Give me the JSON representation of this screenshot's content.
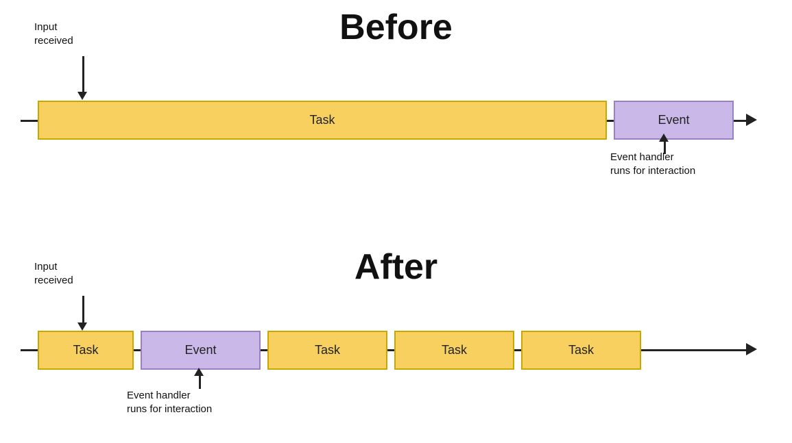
{
  "before": {
    "title": "Before",
    "input_label": "Input\nreceived",
    "task_label": "Task",
    "event_label": "Event",
    "event_handler_label": "Event handler\nruns for interaction"
  },
  "after": {
    "title": "After",
    "input_label": "Input\nreceived",
    "task_label": "Task",
    "event_label": "Event",
    "event_handler_label": "Event handler\nruns for interaction",
    "task2_label": "Task",
    "task3_label": "Task",
    "task4_label": "Task"
  }
}
